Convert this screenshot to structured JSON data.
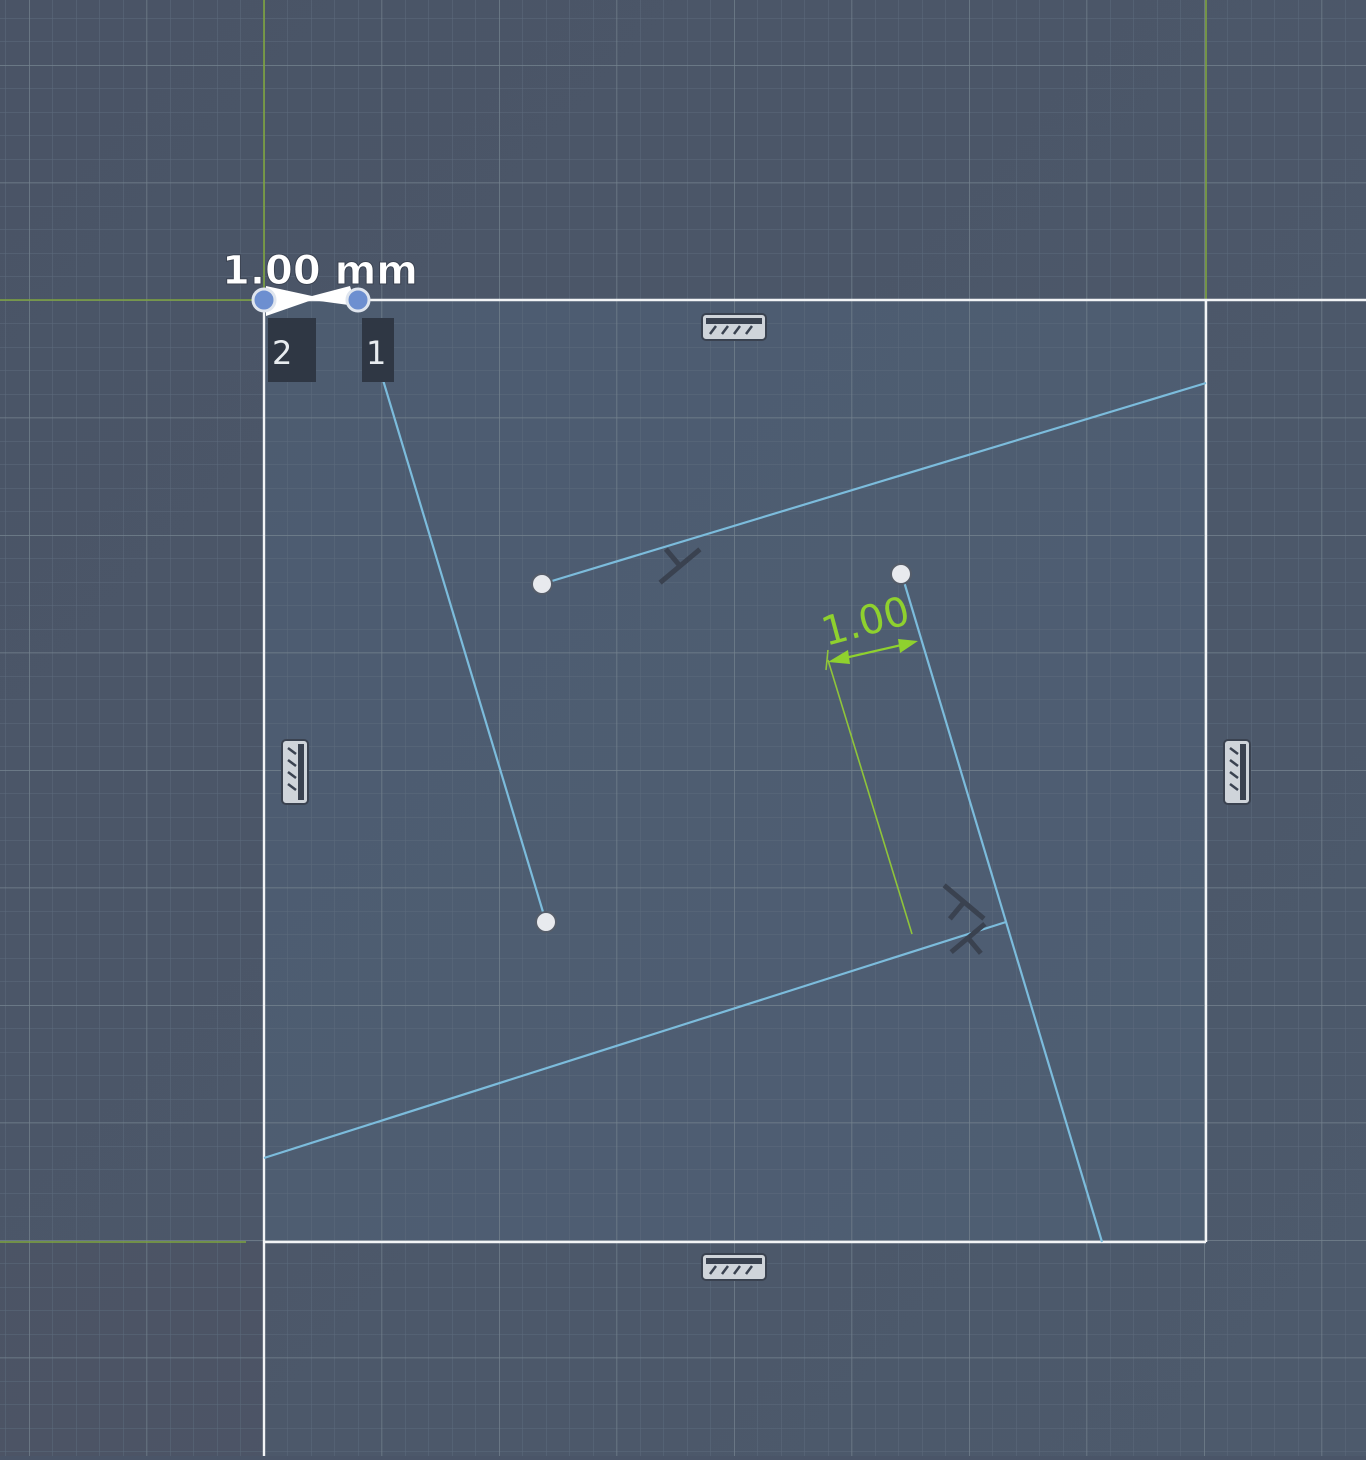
{
  "sketch": {
    "dimension_label": "1.00 mm",
    "offset_dimension_label": "1.00",
    "point_badges": [
      "2",
      "1"
    ]
  },
  "colors": {
    "background_dark": "#4b5466",
    "background_light": "#4d5d6e",
    "grid_minor": "#5b697b",
    "grid_major": "#6e7c8d",
    "profile_white": "#f2f4f6",
    "sketch_line": "#78b7d8",
    "dimension_green": "#8fd12e",
    "axis_green": "#7aa43a",
    "constraint_icon": "#394150",
    "badge_bg": "#2f3744"
  },
  "icons": {
    "horizontal_constraint": "horizontal-constraint-icon",
    "vertical_constraint": "vertical-constraint-icon",
    "perpendicular_constraint": "perpendicular-constraint-icon",
    "sketch_point": "sketch-point-icon"
  }
}
